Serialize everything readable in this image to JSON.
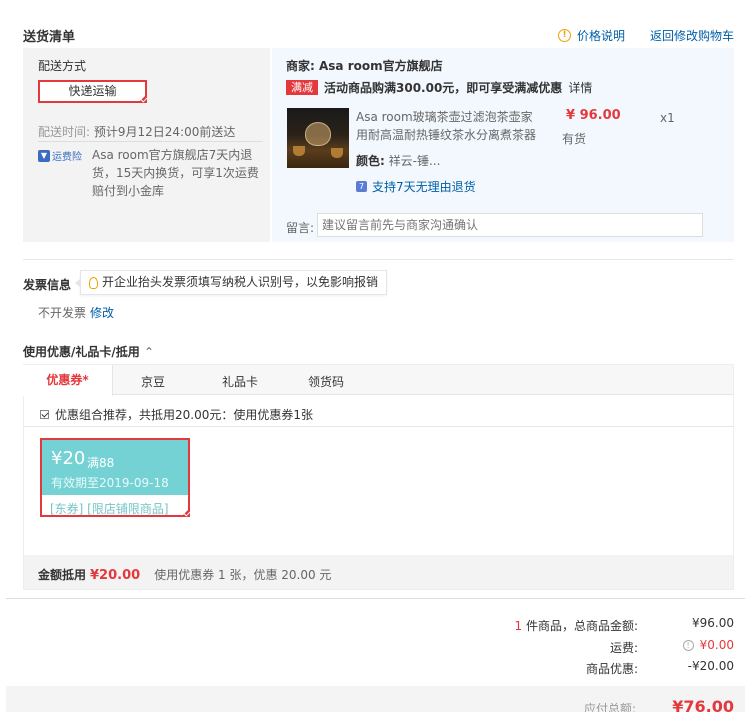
{
  "header": {
    "title": "送货清单",
    "price_info": "价格说明",
    "back_to_cart": "返回修改购物车"
  },
  "delivery": {
    "label": "配送方式",
    "option": "快递运输",
    "time_label": "配送时间:",
    "time_value": "预计9月12日24:00前送达",
    "insurance_badge": "运费险",
    "insurance_text": "Asa room官方旗舰店7天内退货，15天内换货，可享1次运费赔付到小金库"
  },
  "merchant": {
    "label": "商家:",
    "name": "Asa room官方旗舰店",
    "promo_tag": "满减",
    "promo_text": "活动商品购满300.00元，即可享受满减优惠",
    "promo_detail": "详情"
  },
  "product": {
    "name": "Asa room玻璃茶壶过滤泡茶壶家用耐高温耐热锤纹茶水分离煮茶器",
    "price": "¥ 96.00",
    "stock": "有货",
    "qty": "x1",
    "color_label": "颜色:",
    "color_value": "祥云-锤...",
    "return_badge": "7",
    "return_text": "支持7天无理由退货"
  },
  "message": {
    "label": "留言:",
    "placeholder": "建议留言前先与商家沟通确认"
  },
  "invoice": {
    "title": "发票信息",
    "tip": "开企业抬头发票须填写纳税人识别号，以免影响报销",
    "status": "不开发票",
    "edit": "修改"
  },
  "coupons": {
    "title": "使用优惠/礼品卡/抵用",
    "tabs": [
      "优惠券*",
      "京豆",
      "礼品卡",
      "领货码"
    ],
    "combo_text": "优惠组合推荐，共抵用20.00元：使用优惠券1张",
    "card": {
      "amount": "¥20",
      "condition": "满88",
      "expiry": "有效期至2019-09-18",
      "tags": "[东券] [限店铺限商品]"
    },
    "summary_label": "金额抵用",
    "summary_amount": "¥20.00",
    "summary_desc": "使用优惠券 1 张，优惠 20.00 元"
  },
  "totals": {
    "count_num": "1",
    "count_label": "件商品，总商品金额:",
    "goods_total": "¥96.00",
    "shipping_label": "运费:",
    "shipping_value": "¥0.00",
    "discount_label": "商品优惠:",
    "discount_value": "-¥20.00",
    "payable_label": "应付总额:",
    "payable_value": "¥76.00"
  },
  "colors": {
    "accent_red": "#e4393c",
    "link_blue": "#005ea7",
    "coupon_teal": "#74d2d4"
  }
}
